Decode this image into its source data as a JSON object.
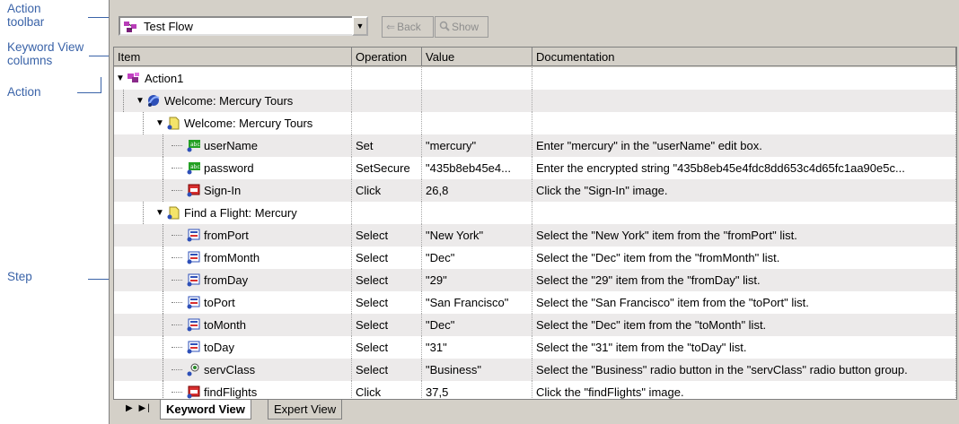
{
  "callouts": [
    {
      "label": "Action\ntoolbar"
    },
    {
      "label": "Keyword View\ncolumns"
    },
    {
      "label": "Action"
    },
    {
      "label": "Step"
    }
  ],
  "toolbar": {
    "combo_value": "Test Flow",
    "back_label": "Back",
    "show_label": "Show"
  },
  "columns": [
    "Item",
    "Operation",
    "Value",
    "Documentation"
  ],
  "rows": [
    {
      "item": "Action1",
      "operation": "",
      "value": "",
      "doc": "",
      "icon": "action-icon"
    },
    {
      "item": "Welcome: Mercury Tours",
      "operation": "",
      "value": "",
      "doc": "",
      "icon": "browser-icon"
    },
    {
      "item": "Welcome: Mercury Tours",
      "operation": "",
      "value": "",
      "doc": "",
      "icon": "page-icon"
    },
    {
      "item": "userName",
      "operation": "Set",
      "value": "\"mercury\"",
      "doc": "Enter \"mercury\" in the \"userName\" edit box.",
      "icon": "editbox-icon"
    },
    {
      "item": "password",
      "operation": "SetSecure",
      "value": "\"435b8eb45e4...",
      "doc": "Enter the encrypted string \"435b8eb45e4fdc8dd653c4d65fc1aa90e5c...",
      "icon": "editbox-icon"
    },
    {
      "item": "Sign-In",
      "operation": "Click",
      "value": "26,8",
      "doc": "Click the \"Sign-In\" image.",
      "icon": "image-icon"
    },
    {
      "item": "Find a Flight: Mercury",
      "operation": "",
      "value": "",
      "doc": "",
      "icon": "page-icon"
    },
    {
      "item": "fromPort",
      "operation": "Select",
      "value": "\"New York\"",
      "doc": "Select the \"New York\" item from the \"fromPort\" list.",
      "icon": "list-icon"
    },
    {
      "item": "fromMonth",
      "operation": "Select",
      "value": "\"Dec\"",
      "doc": "Select the \"Dec\" item from the \"fromMonth\" list.",
      "icon": "list-icon"
    },
    {
      "item": "fromDay",
      "operation": "Select",
      "value": "\"29\"",
      "doc": "Select the \"29\" item from the \"fromDay\" list.",
      "icon": "list-icon"
    },
    {
      "item": "toPort",
      "operation": "Select",
      "value": "\"San Francisco\"",
      "doc": "Select the \"San Francisco\" item from the \"toPort\" list.",
      "icon": "list-icon"
    },
    {
      "item": "toMonth",
      "operation": "Select",
      "value": "\"Dec\"",
      "doc": "Select the \"Dec\" item from the \"toMonth\" list.",
      "icon": "list-icon"
    },
    {
      "item": "toDay",
      "operation": "Select",
      "value": "\"31\"",
      "doc": "Select the \"31\" item from the \"toDay\" list.",
      "icon": "list-icon"
    },
    {
      "item": "servClass",
      "operation": "Select",
      "value": "\"Business\"",
      "doc": "Select the \"Business\" radio button in the \"servClass\" radio button group.",
      "icon": "radio-icon"
    },
    {
      "item": "findFlights",
      "operation": "Click",
      "value": "37,5",
      "doc": "Click the \"findFlights\" image.",
      "icon": "image-icon"
    }
  ],
  "tabs": [
    {
      "label": "Keyword View",
      "active": true
    },
    {
      "label": "Expert View",
      "active": false
    }
  ],
  "colors": {
    "callout": "#3a63a8",
    "chrome": "#d4d0c8",
    "row_alt": "#eceaea"
  }
}
